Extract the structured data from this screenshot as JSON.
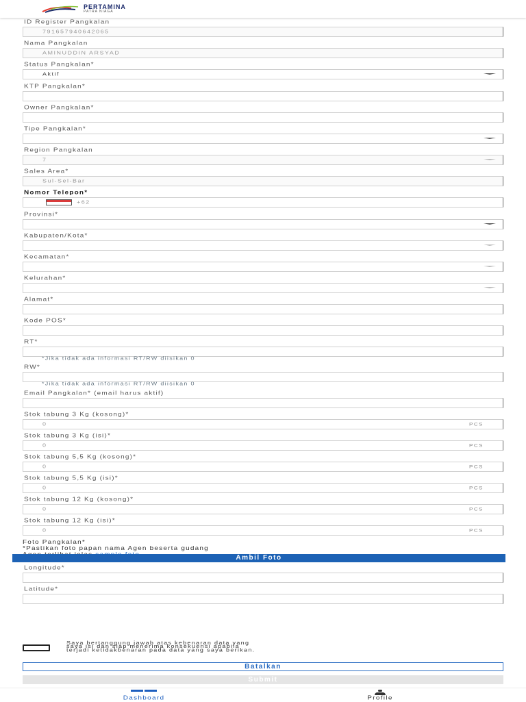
{
  "header": {
    "brand_name": "PERTAMINA",
    "brand_sub": "PATRA NIAGA",
    "colors": {
      "blue": "#1b2a6b",
      "red": "#e63a2e",
      "green": "#8ac43f"
    }
  },
  "form": {
    "id_register": {
      "label": "ID Register Pangkalan",
      "value": "791657940642065"
    },
    "nama": {
      "label": "Nama Pangkalan",
      "value": "AMINUDDIN ARSYAD"
    },
    "status": {
      "label": "Status Pangkalan*",
      "value": "Aktif"
    },
    "ktp": {
      "label": "KTP Pangkalan*",
      "value": ""
    },
    "owner": {
      "label": "Owner Pangkalan*",
      "value": ""
    },
    "tipe": {
      "label": "Tipe Pangkalan*",
      "value": ""
    },
    "region": {
      "label": "Region Pangkalan",
      "value": "7"
    },
    "sales_area": {
      "label": "Sales Area*",
      "value": "Sul-Sel-Bar"
    },
    "telepon": {
      "label": "Nomor Telepon*",
      "prefix": "+62",
      "value": ""
    },
    "provinsi": {
      "label": "Provinsi*",
      "value": ""
    },
    "kabupaten": {
      "label": "Kabupaten/Kota*",
      "value": ""
    },
    "kecamatan": {
      "label": "Kecamatan*",
      "value": ""
    },
    "kelurahan": {
      "label": "Kelurahan*",
      "value": ""
    },
    "alamat": {
      "label": "Alamat*",
      "value": ""
    },
    "kode_pos": {
      "label": "Kode POS*",
      "value": ""
    },
    "rt": {
      "label": "RT*",
      "value": "",
      "hint": "*Jika tidak ada informasi RT/RW diisikan 0"
    },
    "rw": {
      "label": "RW*",
      "value": "",
      "hint": "*Jika tidak ada informasi RT/RW diisikan 0"
    },
    "email": {
      "label": "Email Pangkalan* (email harus aktif)",
      "value": ""
    },
    "stok": [
      {
        "label": "Stok tabung 3 Kg (kosong)*",
        "value": "0",
        "unit": "PCS"
      },
      {
        "label": "Stok tabung 3 Kg (isi)*",
        "value": "0",
        "unit": "PCS"
      },
      {
        "label": "Stok tabung 5,5 Kg (kosong)*",
        "value": "0",
        "unit": "PCS"
      },
      {
        "label": "Stok tabung 5,5 Kg (isi)*",
        "value": "0",
        "unit": "PCS"
      },
      {
        "label": "Stok tabung 12 Kg (kosong)*",
        "value": "0",
        "unit": "PCS"
      },
      {
        "label": "Stok tabung 12 Kg (isi)*",
        "value": "0",
        "unit": "PCS"
      }
    ],
    "foto": {
      "label": "Foto Pangkalan*",
      "desc_line1": "*Pastikan foto papan nama Agen beserta gudang",
      "desc_line2": "Agen terlihat jelas",
      "sample_link": "sample foto",
      "button": "Ambil Foto"
    },
    "longitude": {
      "label": "Longitude*",
      "value": ""
    },
    "latitude": {
      "label": "Latitude*",
      "value": ""
    },
    "agreement": {
      "line1": "Saya bertanggung jawab atas kebenaran data yang",
      "line2": "saya isi dan siap menerima konsekuensi apabila",
      "line3": "terjadi ketidakbenaran pada data yang saya berikan."
    },
    "cancel_label": "Batalkan",
    "submit_label": "Submit"
  },
  "bottom_nav": {
    "dashboard": {
      "label": "Dashboard",
      "icon": "dashboard-icon"
    },
    "profile": {
      "label": "Profile",
      "icon": "person-icon"
    }
  }
}
